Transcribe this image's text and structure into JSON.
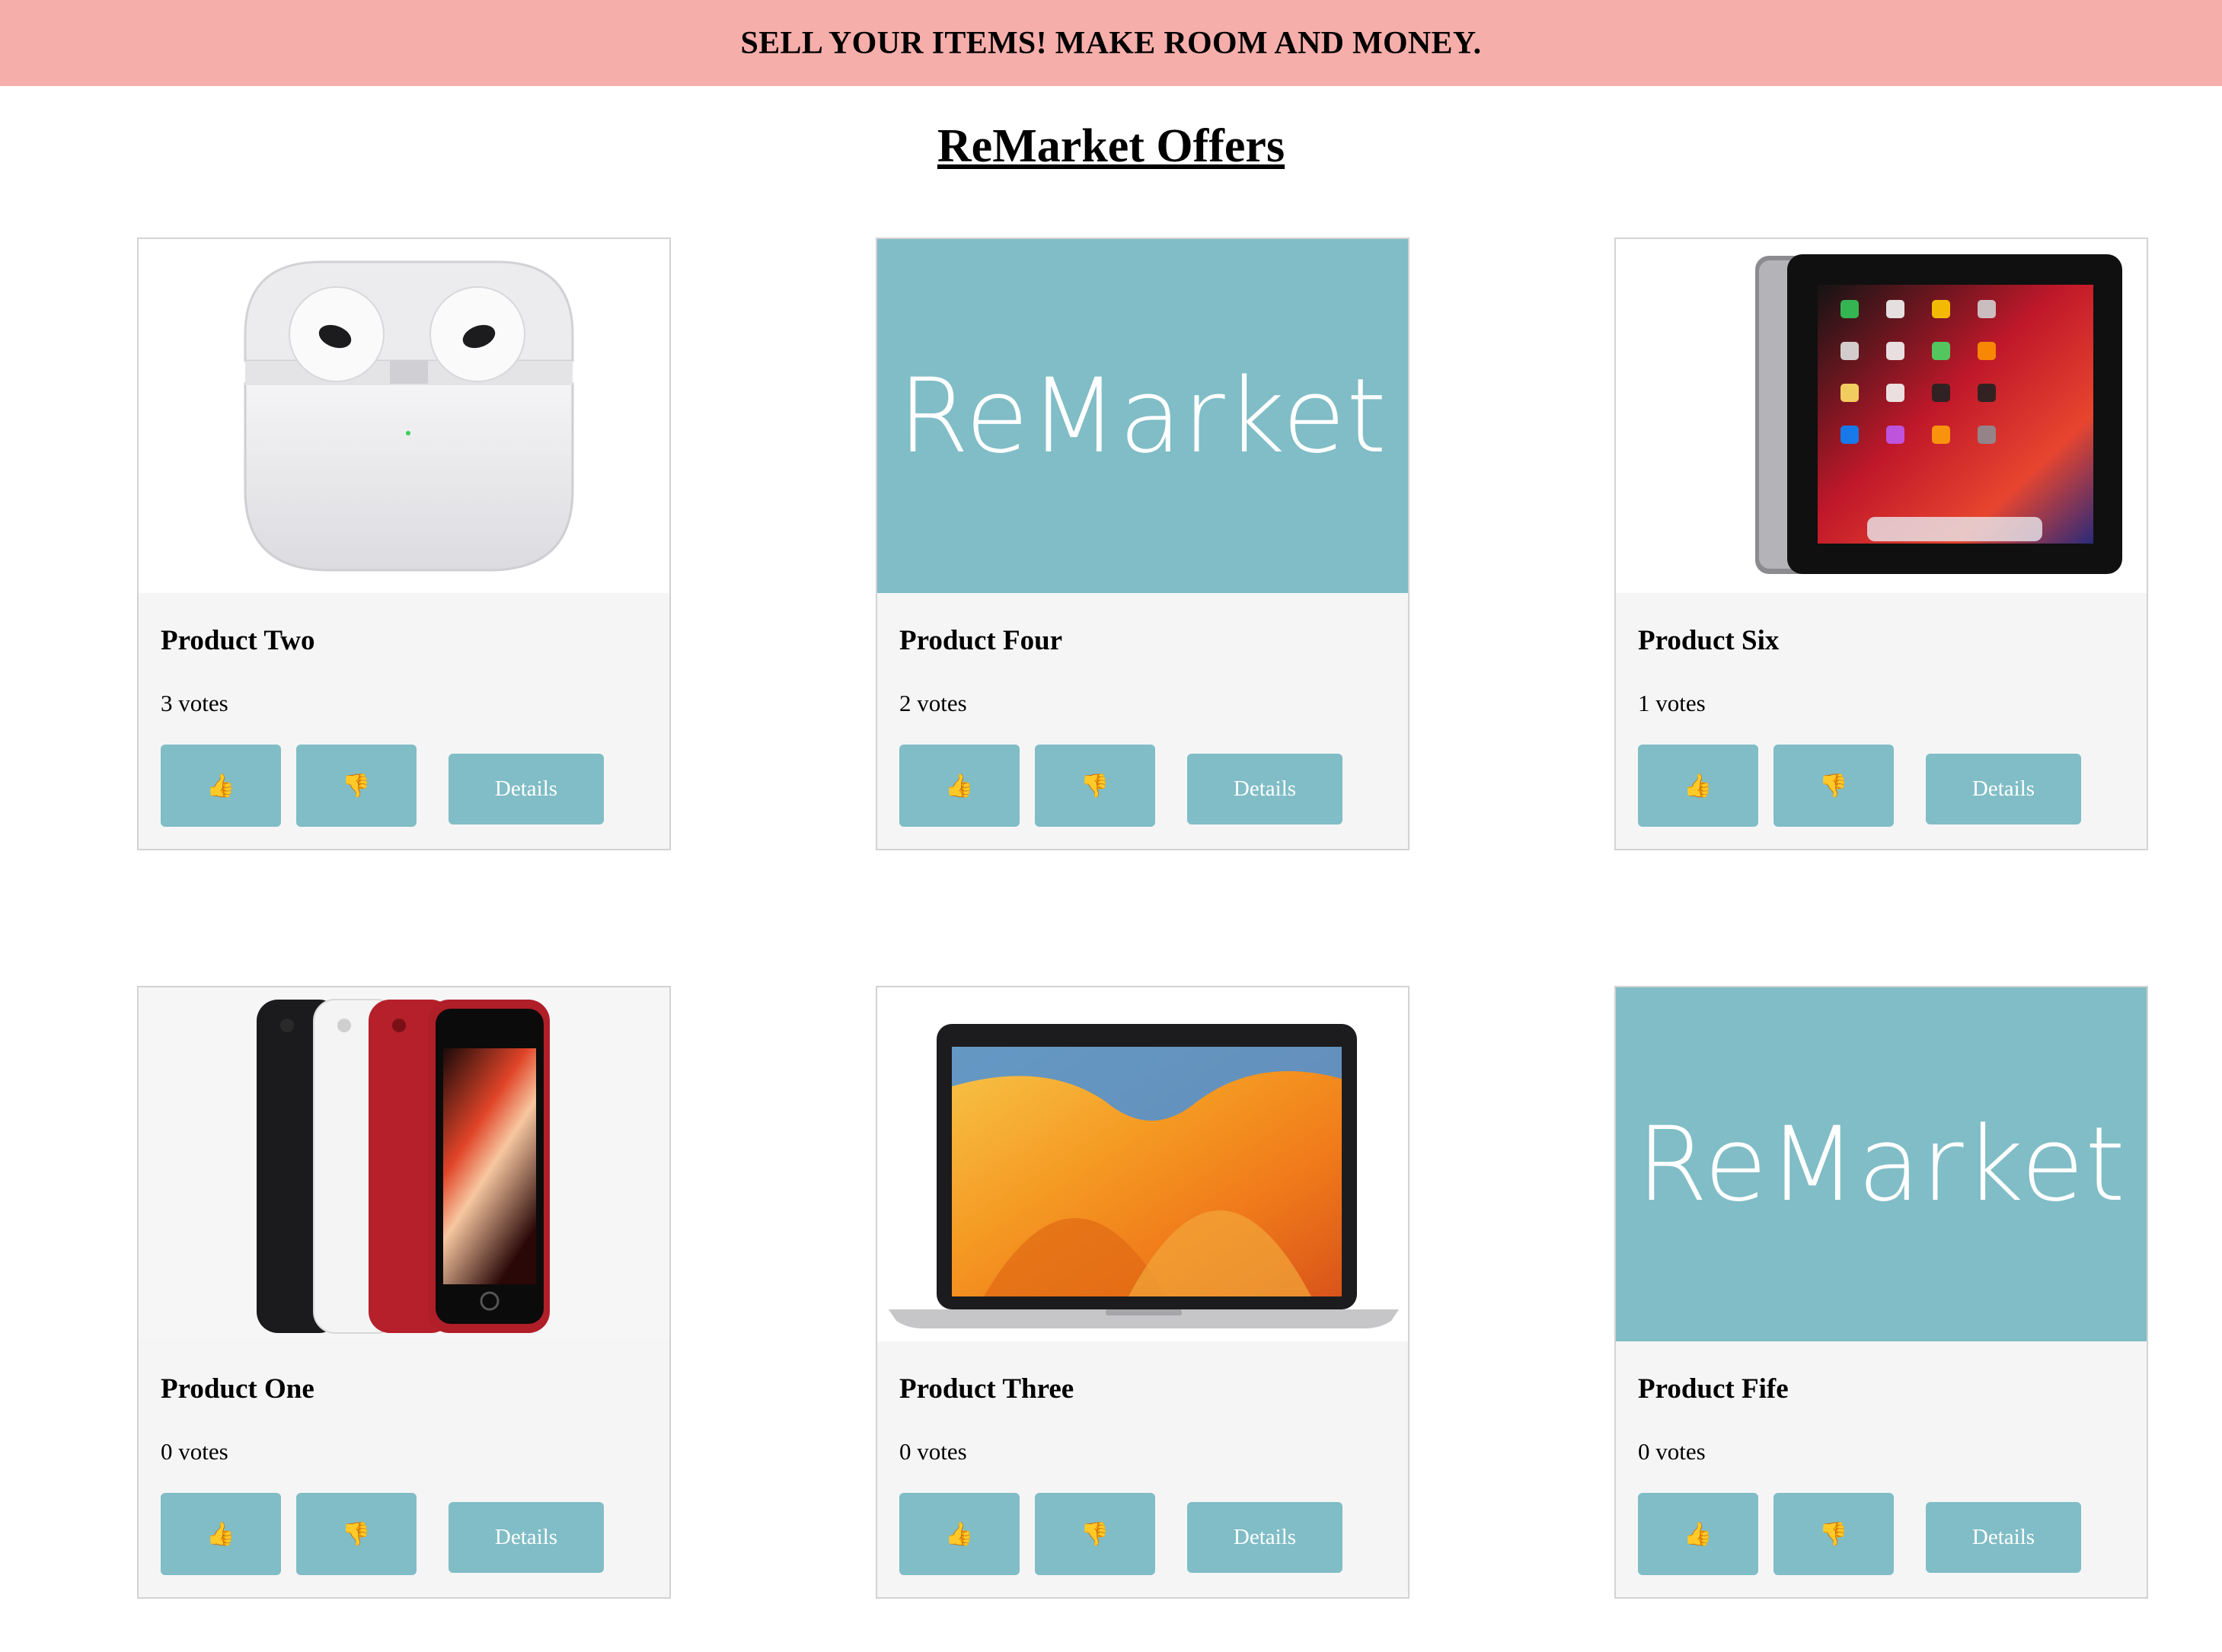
{
  "banner": {
    "text": "SELL YOUR ITEMS! MAKE ROOM AND MONEY."
  },
  "page": {
    "title": "ReMarket Offers"
  },
  "brand": {
    "logo_text": "ReMarket",
    "accent": "#80bdc6",
    "banner_color": "#f6aeab"
  },
  "products": [
    {
      "name": "Product Two",
      "votes": "3 votes",
      "image": "airpods-image",
      "up_label": "👍",
      "down_label": "👎",
      "details_label": "Details"
    },
    {
      "name": "Product Four",
      "votes": "2 votes",
      "image": "remarket-logo",
      "up_label": "👍",
      "down_label": "👎",
      "details_label": "Details"
    },
    {
      "name": "Product Six",
      "votes": "1 votes",
      "image": "ipad-image",
      "up_label": "👍",
      "down_label": "👎",
      "details_label": "Details"
    },
    {
      "name": "Product One",
      "votes": "0 votes",
      "image": "iphones-image",
      "up_label": "👍",
      "down_label": "👎",
      "details_label": "Details"
    },
    {
      "name": "Product Three",
      "votes": "0 votes",
      "image": "macbook-image",
      "up_label": "👍",
      "down_label": "👎",
      "details_label": "Details"
    },
    {
      "name": "Product Fife",
      "votes": "0 votes",
      "image": "remarket-logo",
      "up_label": "👍",
      "down_label": "👎",
      "details_label": "Details"
    }
  ]
}
